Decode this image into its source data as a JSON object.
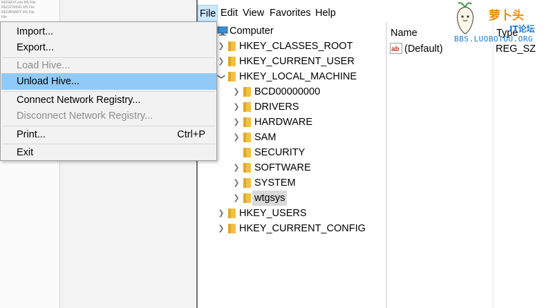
{
  "menubar": {
    "file": "File",
    "edit": "Edit",
    "view": "View",
    "favorites": "Favorites",
    "help": "Help"
  },
  "file_menu": {
    "import": "Import...",
    "export": "Export...",
    "load_hive": "Load Hive...",
    "unload_hive": "Unload Hive...",
    "connect": "Connect Network Registry...",
    "disconnect": "Disconnect Network Registry...",
    "print": "Print...",
    "print_shortcut": "Ctrl+P",
    "exit": "Exit"
  },
  "tree": {
    "root": "Computer",
    "hkcr": "HKEY_CLASSES_ROOT",
    "hkcu": "HKEY_CURRENT_USER",
    "hklm": "HKEY_LOCAL_MACHINE",
    "hklm_children": [
      "BCD00000000",
      "DRIVERS",
      "HARDWARE",
      "SAM",
      "SECURITY",
      "SOFTWARE",
      "SYSTEM",
      "wtgsys"
    ],
    "hku": "HKEY_USERS",
    "hkcc": "HKEY_CURRENT_CONFIG"
  },
  "values_pane": {
    "col_name": "Name",
    "col_type": "Type",
    "rows": [
      {
        "name": "(Default)",
        "type": "REG_SZ"
      }
    ]
  },
  "watermark": {
    "brand": "萝卜头",
    "sub": "IT论坛",
    "url": "BBS.LUOBOTOU.ORG"
  },
  "background_window_lines": [
    "REGEDIT.exe MS File",
    "REGSTRING MS File",
    "REGBINARY MS File",
    "File"
  ],
  "colors": {
    "menu_highlight": "#91c9f7",
    "menubar_active": "#cce8ff",
    "folder": "#f2c043",
    "watermark_orange": "#f08a00",
    "watermark_blue": "#1a7ad6"
  }
}
